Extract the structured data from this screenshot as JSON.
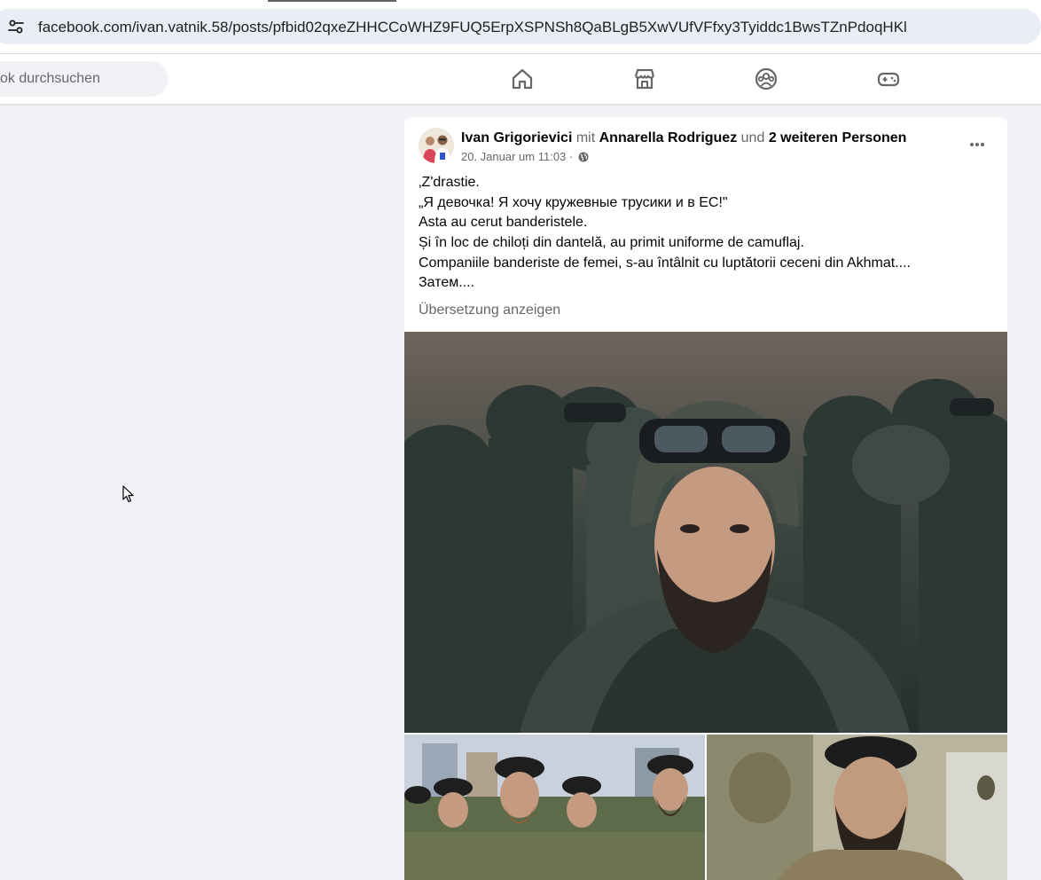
{
  "browser": {
    "url": "facebook.com/ivan.vatnik.58/posts/pfbid02qxeZHHCCoWHZ9FUQ5ErpXSPNSh8QaBLgB5XwVUfVFfxy3Tyiddc1BwsTZnPdoqHKl",
    "site_info_icon": "tune-icon"
  },
  "nav": {
    "search_placeholder": "ok durchsuchen",
    "icons": [
      "home-icon",
      "marketplace-icon",
      "groups-icon",
      "gaming-icon"
    ]
  },
  "post": {
    "author": "Ivan Grigorievici",
    "with_word": "mit",
    "tagged": "Annarella Rodriguez",
    "and_word": "und",
    "others": "2 weiteren Personen",
    "timestamp": "20. Januar um 11:03 ·",
    "privacy_icon": "globe-icon",
    "text_lines": [
      "‚Z'drastie.",
      "„Я девочка! Я хочу кружевные трусики и в ЕС!\"",
      "Asta au cerut banderistele.",
      "Și în loc de chiloți din dantelă, au primit uniforme de camuflaj.",
      "Companiile banderiste de femei, s-au întâlnit cu luptătorii ceceni din Akhmat....",
      "Затем...."
    ],
    "see_translation": "Übersetzung anzeigen",
    "more_icon": "more-icon"
  },
  "colors": {
    "page_bg": "#f0f2f5",
    "muted_text": "#65676b",
    "url_pill": "#e9edf6"
  }
}
